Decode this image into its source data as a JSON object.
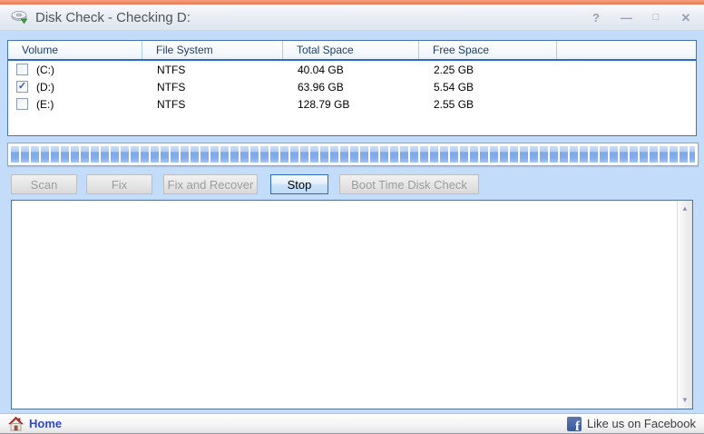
{
  "title_bar": {
    "title": "Disk Check - Checking D:",
    "help_glyph": "?",
    "minimize_glyph": "—",
    "maximize_glyph": "□",
    "close_glyph": "✕"
  },
  "volume_table": {
    "headers": {
      "volume": "Volume",
      "file_system": "File System",
      "total_space": "Total Space",
      "free_space": "Free Space"
    },
    "rows": [
      {
        "check": "",
        "volume": "(C:)",
        "file_system": "NTFS",
        "total_space": "40.04 GB",
        "free_space": "2.25 GB"
      },
      {
        "check": "✓",
        "volume": "(D:)",
        "file_system": "NTFS",
        "total_space": "63.96 GB",
        "free_space": "5.54 GB"
      },
      {
        "check": "",
        "volume": "(E:)",
        "file_system": "NTFS",
        "total_space": "128.79 GB",
        "free_space": "2.55 GB"
      }
    ]
  },
  "buttons": {
    "scan": "Scan",
    "fix": "Fix",
    "fix_and_recover": "Fix and Recover",
    "stop": "Stop",
    "boot_time_disk_check": "Boot Time Disk Check"
  },
  "icons": {
    "scroll_up": "▲",
    "scroll_down": "▼"
  },
  "footer": {
    "home": "Home",
    "facebook": "Like us on Facebook",
    "facebook_f": "f"
  },
  "colors": {
    "accent_blue": "#2f6bc2",
    "body_blue": "#c3dcfa",
    "top_orange": "#ef8560",
    "facebook_blue": "#3b5998",
    "link_blue": "#2b49cf"
  }
}
